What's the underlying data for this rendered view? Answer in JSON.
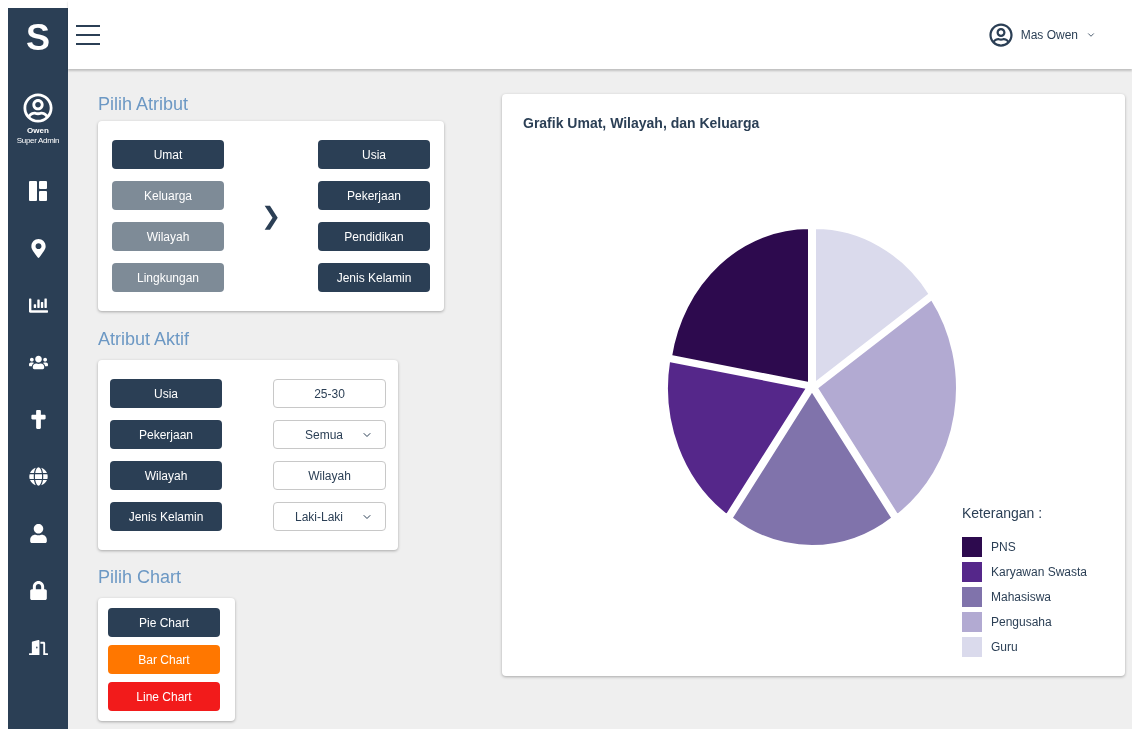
{
  "sidebar": {
    "logo": "S",
    "user": {
      "name": "Owen",
      "role": "Super Admin"
    }
  },
  "header": {
    "user_name": "Mas Owen"
  },
  "pilih_atribut": {
    "title": "Pilih Atribut",
    "groups": [
      {
        "label": "Umat",
        "selected": true
      },
      {
        "label": "Keluarga",
        "selected": false
      },
      {
        "label": "Wilayah",
        "selected": false
      },
      {
        "label": "Lingkungan",
        "selected": false
      }
    ],
    "arrow": "❯",
    "attributes": [
      {
        "label": "Usia"
      },
      {
        "label": "Pekerjaan"
      },
      {
        "label": "Pendidikan"
      },
      {
        "label": "Jenis Kelamin"
      }
    ]
  },
  "atribut_aktif": {
    "title": "Atribut Aktif",
    "rows": [
      {
        "label": "Usia",
        "kind": "text",
        "value": "25-30"
      },
      {
        "label": "Pekerjaan",
        "kind": "dropdown",
        "value": "Semua"
      },
      {
        "label": "Wilayah",
        "kind": "text",
        "value": "Wilayah"
      },
      {
        "label": "Jenis Kelamin",
        "kind": "dropdown",
        "value": "Laki-Laki"
      }
    ]
  },
  "pilih_chart": {
    "title": "Pilih Chart",
    "buttons": [
      {
        "label": "Pie Chart",
        "color": "#2b3f55"
      },
      {
        "label": "Bar Chart",
        "color": "#ff7700"
      },
      {
        "label": "Line Chart",
        "color": "#f21b1b"
      }
    ]
  },
  "chart": {
    "title": "Grafik Umat, Wilayah, dan Keluarga",
    "legend_title": "Keterangan :",
    "legend": [
      {
        "label": "PNS",
        "color": "#2d0a4e"
      },
      {
        "label": "Karyawan Swasta",
        "color": "#55278a"
      },
      {
        "label": "Mahasiswa",
        "color": "#8073ab"
      },
      {
        "label": "Pengusaha",
        "color": "#b2aad2"
      },
      {
        "label": "Guru",
        "color": "#dadaec"
      }
    ]
  }
}
